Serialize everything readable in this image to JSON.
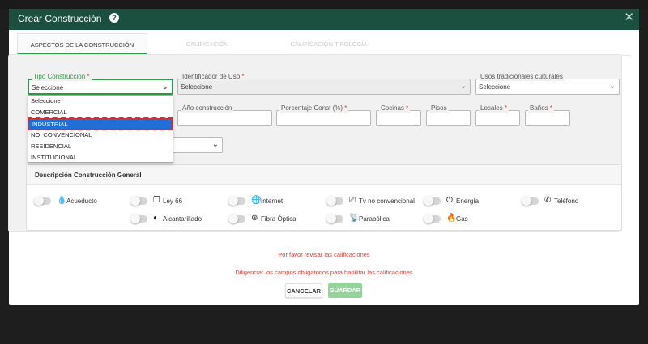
{
  "modal": {
    "title": "Crear Construcción",
    "help_glyph": "?",
    "close_glyph": "✕"
  },
  "tabs": [
    {
      "label": "ASPECTOS DE LA CONSTRUCCIÓN",
      "active": true
    },
    {
      "label": "CALIFICACIÓN",
      "active": false
    },
    {
      "label": "CALIFICACIÓN TIPOLOGÍA",
      "active": false
    }
  ],
  "form": {
    "tipo_construccion": {
      "label": "Tipo Construcción",
      "required": "*",
      "value": "Seleccione"
    },
    "identificador_uso": {
      "label": "Identificador de Uso",
      "required": "*",
      "value": "Seleccione"
    },
    "usos_tradicionales": {
      "label": "Usos tradicionales culturales",
      "value": "Seleccione"
    },
    "anio_construccion": {
      "label": "Año construcción",
      "value": ""
    },
    "porcentaje_const": {
      "label": "Porcentaje Const (%)",
      "required": "*",
      "value": ""
    },
    "cocinas": {
      "label": "Cocinas",
      "required": "*",
      "value": ""
    },
    "pisos": {
      "label": "Pisos",
      "value": ""
    },
    "locales": {
      "label": "Locales",
      "required": "*",
      "value": ""
    },
    "banos": {
      "label": "Baños",
      "required": "*",
      "value": ""
    },
    "extra_select": {
      "value": ""
    }
  },
  "dropdown": {
    "options": [
      "Seleccione",
      "COMERCIAL",
      "INDUSTRIAL",
      "NO_CONVENCIONAL",
      "RESIDENCIAL",
      "INSTITUCIONAL"
    ],
    "highlighted": "INDUSTRIAL"
  },
  "services_card": {
    "title": "Descripción Construcción General",
    "items": [
      {
        "label": "Acueducto",
        "icon": "water-drop-icon",
        "glyph": "💧"
      },
      {
        "label": "Ley 66",
        "icon": "copy-icon",
        "glyph": "❐"
      },
      {
        "label": "Internet",
        "icon": "globe-icon",
        "glyph": "🌐"
      },
      {
        "label": "Tv no convencional",
        "icon": "tv-icon",
        "glyph": "⎚"
      },
      {
        "label": "Energía",
        "icon": "plug-icon",
        "glyph": "⏻"
      },
      {
        "label": "Teléfono",
        "icon": "phone-icon",
        "glyph": "✆"
      },
      {
        "label": "Alcantarillado",
        "icon": "contrast-icon",
        "glyph": "◐"
      },
      {
        "label": "Fibra Óptica",
        "icon": "fiber-icon",
        "glyph": "⊛"
      },
      {
        "label": "Parabólica",
        "icon": "antenna-icon",
        "glyph": "📡"
      },
      {
        "label": "Gas",
        "icon": "flame-icon",
        "glyph": "🔥"
      }
    ]
  },
  "messages": {
    "revisar": "Por favor revisar las calificaciones",
    "diligenciar": "Diligenciar los campos obligatorios para habilitar las calificaciones"
  },
  "buttons": {
    "cancel": "CANCELAR",
    "save": "GUARDAR"
  },
  "colors": {
    "header": "#1b4f3f",
    "accent": "#2e9a47",
    "error": "#e53935",
    "highlight": "#1f6fd6"
  }
}
